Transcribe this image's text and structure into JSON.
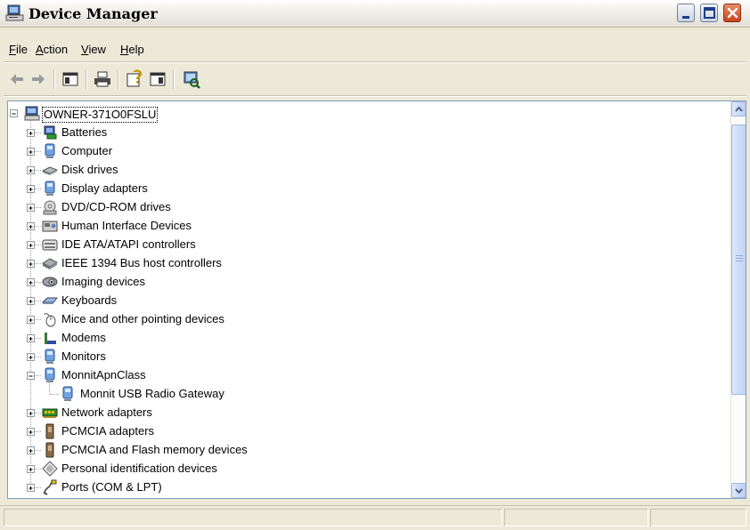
{
  "window": {
    "title": "Device Manager"
  },
  "menu": [
    {
      "label": "File",
      "accel": "F",
      "rest": "ile"
    },
    {
      "label": "Action",
      "accel": "A",
      "rest": "ction"
    },
    {
      "label": "View",
      "accel": "V",
      "rest": "iew"
    },
    {
      "label": "Help",
      "accel": "H",
      "rest": "elp"
    }
  ],
  "toolbar": {
    "icons": [
      "back-arrow-icon",
      "forward-arrow-icon",
      "show-hide-console-tree-icon",
      "print-icon",
      "properties-icon",
      "help-pane-icon",
      "scan-hardware-icon"
    ]
  },
  "tree": {
    "root": "OWNER-371O0FSLU",
    "items": [
      {
        "label": "Batteries",
        "icon": "battery-icon",
        "expanded": false
      },
      {
        "label": "Computer",
        "icon": "computer-icon",
        "expanded": false
      },
      {
        "label": "Disk drives",
        "icon": "disk-drive-icon",
        "expanded": false
      },
      {
        "label": "Display adapters",
        "icon": "display-adapter-icon",
        "expanded": false
      },
      {
        "label": "DVD/CD-ROM drives",
        "icon": "cd-rom-icon",
        "expanded": false
      },
      {
        "label": "Human Interface Devices",
        "icon": "hid-icon",
        "expanded": false
      },
      {
        "label": "IDE ATA/ATAPI controllers",
        "icon": "ide-controller-icon",
        "expanded": false
      },
      {
        "label": "IEEE 1394 Bus host controllers",
        "icon": "ieee1394-icon",
        "expanded": false
      },
      {
        "label": "Imaging devices",
        "icon": "camera-icon",
        "expanded": false
      },
      {
        "label": "Keyboards",
        "icon": "keyboard-icon",
        "expanded": false
      },
      {
        "label": "Mice and other pointing devices",
        "icon": "mouse-icon",
        "expanded": false
      },
      {
        "label": "Modems",
        "icon": "modem-icon",
        "expanded": false
      },
      {
        "label": "Monitors",
        "icon": "monitor-icon",
        "expanded": false
      },
      {
        "label": "MonnitApnClass",
        "icon": "device-class-icon",
        "expanded": true,
        "children": [
          {
            "label": "Monnit USB Radio Gateway",
            "icon": "usb-gateway-icon"
          }
        ]
      },
      {
        "label": "Network adapters",
        "icon": "network-adapter-icon",
        "expanded": false
      },
      {
        "label": "PCMCIA adapters",
        "icon": "pcmcia-icon",
        "expanded": false
      },
      {
        "label": "PCMCIA and Flash memory devices",
        "icon": "flash-memory-icon",
        "expanded": false
      },
      {
        "label": "Personal identification devices",
        "icon": "id-device-icon",
        "expanded": false
      },
      {
        "label": "Ports (COM & LPT)",
        "icon": "port-icon",
        "expanded": false
      }
    ]
  },
  "colors": {
    "selection_border": "#000000",
    "tree_line": "#a0a0a0",
    "scroll": "#c2d3f7",
    "close_button": "#c8421e"
  }
}
